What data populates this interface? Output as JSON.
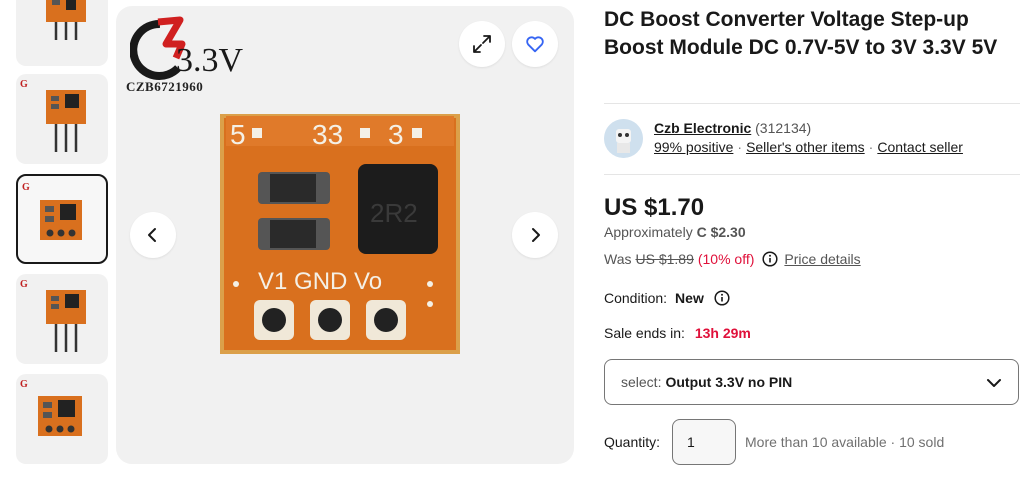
{
  "product": {
    "title": "DC Boost Converter Voltage Step-up Boost Module DC 0.7V-5V to 3V 3.3V 5V"
  },
  "gallery": {
    "watermark_text": "CZB6721960",
    "logo_text": "3.3V",
    "board_labels": {
      "top": "5  33  3",
      "bottom": "V1 GND Vo",
      "inductor": "2R2"
    },
    "thumbnails": [
      "thumb-1",
      "thumb-2",
      "thumb-3",
      "thumb-4",
      "thumb-5"
    ],
    "active_thumbnail": 3,
    "icons": {
      "expand": "expand-icon",
      "favorite": "heart-icon",
      "prev": "chevron-left-icon",
      "next": "chevron-right-icon"
    }
  },
  "seller": {
    "name": "Czb Electronic",
    "feedback_count": "(312134)",
    "positive": "99% positive",
    "other_items": "Seller's other items",
    "contact": "Contact seller"
  },
  "pricing": {
    "price": "US $1.70",
    "approx_label": "Approximately",
    "approx_value": "C $2.30",
    "was_label": "Was",
    "was_price": "US $1.89",
    "discount": "(10% off)",
    "details_link": "Price details"
  },
  "condition": {
    "label": "Condition:",
    "value": "New"
  },
  "sale": {
    "label": "Sale ends in:",
    "timer": "13h 29m"
  },
  "variant_select": {
    "label": "select:",
    "value": "Output 3.3V no PIN"
  },
  "quantity": {
    "label": "Quantity:",
    "value": "1",
    "availability": "More than 10 available · 10 sold"
  },
  "colors": {
    "text": "#191919",
    "secondary": "#555555",
    "sale_red": "#e0103a",
    "border": "#767676",
    "pcb_orange": "#d9701e"
  }
}
